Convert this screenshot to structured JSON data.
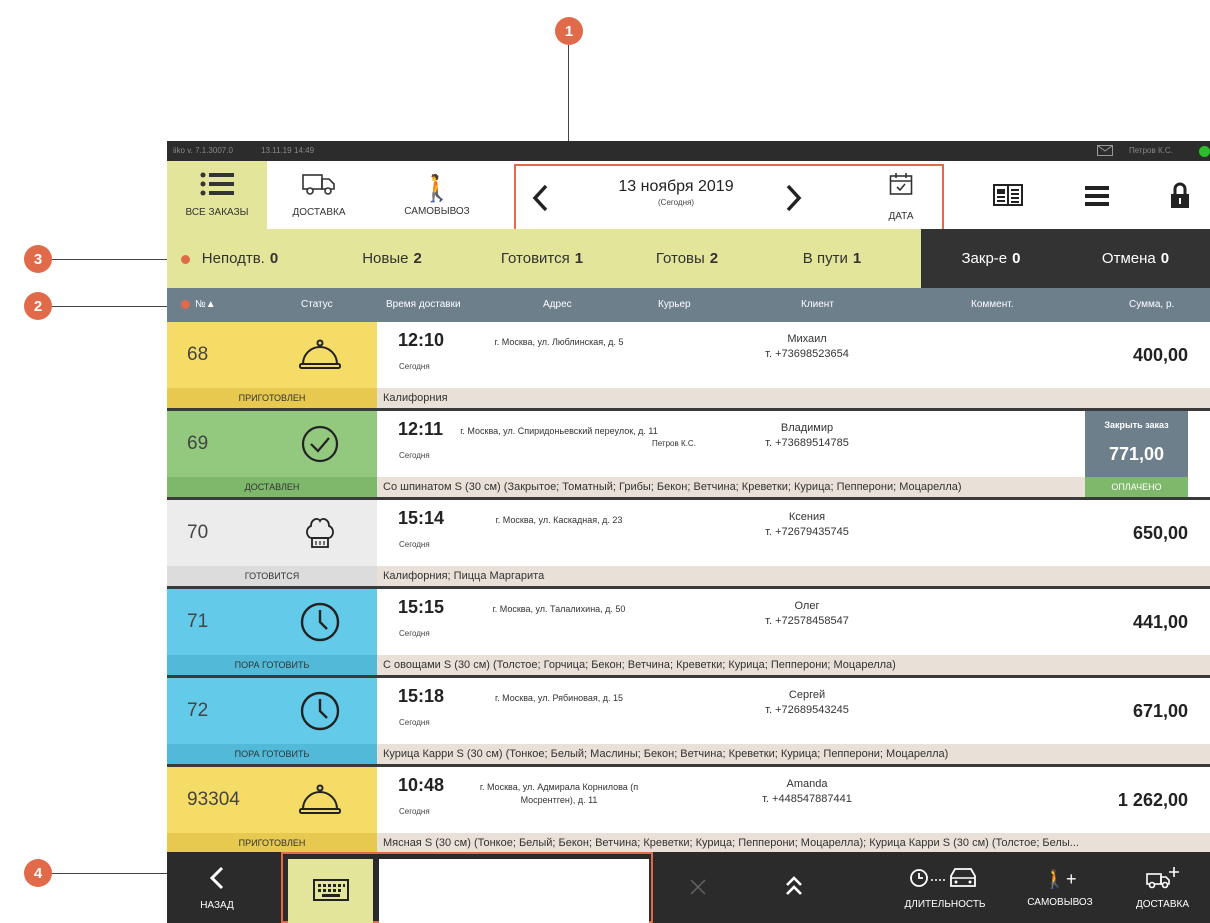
{
  "callouts": [
    "1",
    "2",
    "3",
    "4"
  ],
  "topbar": {
    "version": "iiko v. 7.1.3007.0",
    "date": "13.11.19",
    "time": "14:49",
    "user": "Петров К.С."
  },
  "toolbar": {
    "all_orders": "ВСЕ ЗАКАЗЫ",
    "delivery": "ДОСТАВКА",
    "pickup": "САМОВЫВОЗ",
    "date_main": "13 ноября 2019",
    "date_sub": "(Сегодня)",
    "date_btn": "ДАТА",
    "icons": [
      "list-icon",
      "truck-icon",
      "walking-person-icon",
      "chevron-left-icon",
      "chevron-right-icon",
      "calendar-icon",
      "book-icon",
      "menu-icon",
      "lock-icon"
    ]
  },
  "tabs": [
    {
      "label": "Неподтв.",
      "count": "0"
    },
    {
      "label": "Новые",
      "count": "2"
    },
    {
      "label": "Готовится",
      "count": "1"
    },
    {
      "label": "Готовы",
      "count": "2"
    },
    {
      "label": "В пути",
      "count": "1"
    },
    {
      "label": "Закр-е",
      "count": "0"
    },
    {
      "label": "Отмена",
      "count": "0"
    }
  ],
  "columns": {
    "num": "№▲",
    "status": "Статус",
    "time": "Время доставки",
    "address": "Адрес",
    "courier": "Курьер",
    "client": "Клиент",
    "comment": "Коммент.",
    "sum": "Сумма, р."
  },
  "orders": [
    {
      "num": "68",
      "status": "ПРИГОТОВЛЕН",
      "status_icon": "cloche-icon",
      "color": "#f5dc66",
      "label_color": "#e6c94e",
      "time": "12:10",
      "day": "Сегодня",
      "address": "г. Москва, ул. Люблинская, д. 5",
      "courier": "",
      "client_name": "Михаил",
      "client_phone": "т. +73698523654",
      "sum": "400,00",
      "items": "Калифорния"
    },
    {
      "num": "69",
      "status": "ДОСТАВЛЕН",
      "status_icon": "check-circle-icon",
      "color": "#92c97f",
      "label_color": "#7db86b",
      "time": "12:11",
      "day": "Сегодня",
      "address": "г. Москва, ул. Спиридоньевский переулок, д. 11",
      "courier": "Петров К.С.",
      "client_name": "Владимир",
      "client_phone": "т. +73689514785",
      "sum": "771,00",
      "close_label": "Закрыть заказ",
      "paid_label": "ОПЛАЧЕНО",
      "items": "Со шпинатом S (30 см) (Закрытое; Томатный; Грибы; Бекон; Ветчина; Креветки; Курица; Пепперони; Моцарелла)"
    },
    {
      "num": "70",
      "status": "ГОТОВИТСЯ",
      "status_icon": "chef-hat-icon",
      "color": "#ececec",
      "label_color": "#dcdcdc",
      "time": "15:14",
      "day": "Сегодня",
      "address": "г. Москва, ул. Каскадная, д. 23",
      "courier": "",
      "client_name": "Ксения",
      "client_phone": "т. +72679435745",
      "sum": "650,00",
      "items": "Калифорния; Пицца Маргарита"
    },
    {
      "num": "71",
      "status": "ПОРА ГОТОВИТЬ",
      "status_icon": "clock-icon",
      "color": "#63cbe9",
      "label_color": "#52bad8",
      "time": "15:15",
      "day": "Сегодня",
      "address": "г. Москва, ул. Талалихина, д. 50",
      "courier": "",
      "client_name": "Олег",
      "client_phone": "т. +72578458547",
      "sum": "441,00",
      "items": "С овощами S (30 см) (Толстое; Горчица; Бекон; Ветчина; Креветки; Курица; Пепперони; Моцарелла)"
    },
    {
      "num": "72",
      "status": "ПОРА ГОТОВИТЬ",
      "status_icon": "clock-icon",
      "color": "#63cbe9",
      "label_color": "#52bad8",
      "time": "15:18",
      "day": "Сегодня",
      "address": "г. Москва, ул. Рябиновая, д. 15",
      "courier": "",
      "client_name": "Сергей",
      "client_phone": "т. +72689543245",
      "sum": "671,00",
      "items": "Курица Карри S (30 см) (Тонкое; Белый; Маслины; Бекон; Ветчина; Креветки; Курица; Пепперони; Моцарелла)"
    },
    {
      "num": "93304",
      "status": "ПРИГОТОВЛЕН",
      "status_icon": "cloche-icon",
      "color": "#f5dc66",
      "label_color": "#e6c94e",
      "time": "10:48",
      "day": "Сегодня",
      "address": "г. Москва, ул. Адмирала Корнилова (п Мосрентген), д. 11",
      "courier": "",
      "client_name": "Amanda",
      "client_phone": "т. +448547887441",
      "sum": "1 262,00",
      "items": "Мясная S (30 см) (Тонкое; Белый; Бекон; Ветчина; Креветки; Курица; Пепперони; Моцарелла); Курица Карри S (30 см) (Толстое; Белы..."
    }
  ],
  "bottom": {
    "back": "НАЗАД",
    "duration": "ДЛИТЕЛЬНОСТЬ",
    "pickup": "САМОВЫВОЗ",
    "delivery": "ДОСТАВКА",
    "search_value": "",
    "icons": [
      "chevron-left-icon",
      "keyboard-icon",
      "close-icon",
      "double-chevron-up-icon",
      "clock-car-icon",
      "walking-person-plus-icon",
      "truck-plus-icon"
    ]
  },
  "colors": {
    "accent": "#e06a4a",
    "tabs_bg": "#e2e59a",
    "header_bg": "#6e7f8c",
    "dark": "#2b2b2b",
    "status_green": "#2bbf2b"
  }
}
